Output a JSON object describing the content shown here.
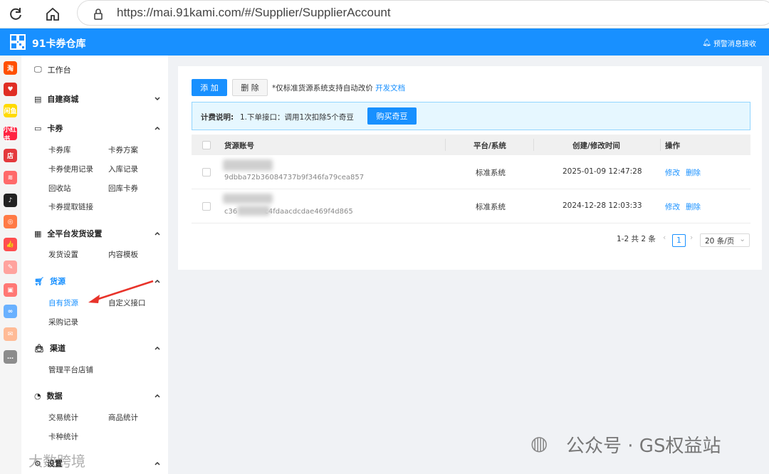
{
  "browser": {
    "url": "https://mai.91kami.com/#/Supplier/SupplierAccount",
    "refresh_icon": "refresh-icon",
    "home_icon": "home-icon",
    "site_info_icon": "lock-icon"
  },
  "app": {
    "title": "91卡券仓库",
    "alert_label": "预警消息接收",
    "accent": "#1890ff"
  },
  "side_strip": [
    {
      "name": "taobao",
      "label": "淘",
      "color": "#ff5000"
    },
    {
      "name": "pinduoduo",
      "label": "♥",
      "color": "#e02e24"
    },
    {
      "name": "xianyu",
      "label": "闲鱼",
      "color": "#ffda00"
    },
    {
      "name": "xiaohongshu",
      "label": "小红书",
      "color": "#ff2442"
    },
    {
      "name": "shop",
      "label": "店",
      "color": "#e4393c"
    },
    {
      "name": "wechat-shop",
      "label": "≋",
      "color": "#ff6a6a"
    },
    {
      "name": "douyin",
      "label": "♪",
      "color": "#222222"
    },
    {
      "name": "apps",
      "label": "◎",
      "color": "#ff7a45"
    },
    {
      "name": "like",
      "label": "👍",
      "color": "#ff4d4f"
    },
    {
      "name": "edit",
      "label": "✎",
      "color": "#ffa39e"
    },
    {
      "name": "box",
      "label": "▣",
      "color": "#ff7875"
    },
    {
      "name": "link",
      "label": "∞",
      "color": "#69b1ff"
    },
    {
      "name": "card",
      "label": "✉",
      "color": "#ffbb96"
    },
    {
      "name": "more",
      "label": "…",
      "color": "#8c8c8c"
    }
  ],
  "sidebar": {
    "workbench": "工作台",
    "groups": {
      "mall": "自建商城",
      "card": "卡券",
      "shipping": "全平台发货设置",
      "source": "货源",
      "channel": "渠道",
      "data": "数据",
      "settings": "设置"
    },
    "card_items": [
      "卡券库",
      "卡券方案",
      "卡券使用记录",
      "入库记录",
      "回收站",
      "回库卡券",
      "卡券提取链接"
    ],
    "shipping_items": [
      "发货设置",
      "内容模板"
    ],
    "source_items": [
      "自有货源",
      "自定义接口",
      "采购记录"
    ],
    "channel_items": [
      "管理平台店铺"
    ],
    "data_items": [
      "交易统计",
      "商品统计",
      "卡种统计"
    ]
  },
  "toolbar": {
    "add_label": "添 加",
    "delete_label": "删 除",
    "note": "*仅标准货源系统支持自动改价",
    "doc_link": "开发文档"
  },
  "billing": {
    "label": "计费说明:",
    "text": "1.下单接口：调用1次扣除5个奇豆",
    "buy_button": "购买奇豆"
  },
  "table": {
    "headers": [
      "货源账号",
      "平台/系统",
      "创建/修改时间",
      "操作"
    ],
    "rows": [
      {
        "account": "9dbba72b36084737b9f346fa79cea857",
        "platform": "标准系统",
        "time": "2025-01-09 12:47:28",
        "edit": "修改",
        "delete": "删除"
      },
      {
        "account": "c36            c4fdaacdcdae469f4d865",
        "platform": "标准系统",
        "time": "2024-12-28 12:03:33",
        "edit": "修改",
        "delete": "删除"
      }
    ]
  },
  "pagination": {
    "summary": "1-2 共 2 条",
    "current_page": "1",
    "page_size": "20 条/页"
  },
  "watermarks": {
    "right": "公众号 · GS权益站",
    "left": "大数跨境"
  }
}
